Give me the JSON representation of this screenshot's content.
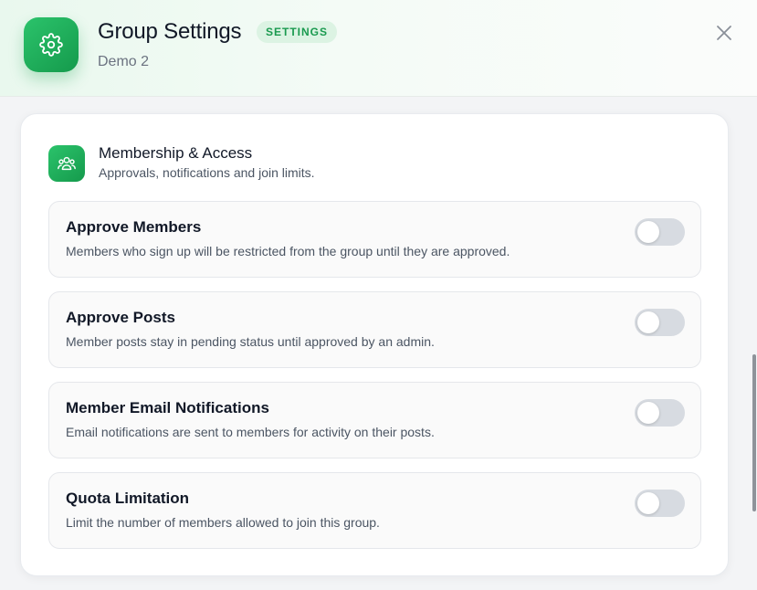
{
  "header": {
    "title": "Group Settings",
    "badge": "SETTINGS",
    "subtitle": "Demo 2",
    "icon": "gear-icon",
    "close_icon": "close-icon"
  },
  "section": {
    "icon": "users-icon",
    "title": "Membership & Access",
    "subtitle": "Approvals, notifications and join limits."
  },
  "settings": [
    {
      "title": "Approve Members",
      "description": "Members who sign up will be restricted from the group until they are approved.",
      "enabled": false
    },
    {
      "title": "Approve Posts",
      "description": "Member posts stay in pending status until approved by an admin.",
      "enabled": false
    },
    {
      "title": "Member Email Notifications",
      "description": "Email notifications are sent to members for activity on their posts.",
      "enabled": false
    },
    {
      "title": "Quota Limitation",
      "description": "Limit the number of members allowed to join this group.",
      "enabled": false
    }
  ],
  "colors": {
    "accent": "#1fae5b",
    "badge_bg": "#dcf3e3",
    "toggle_off": "#d7dbe1"
  }
}
